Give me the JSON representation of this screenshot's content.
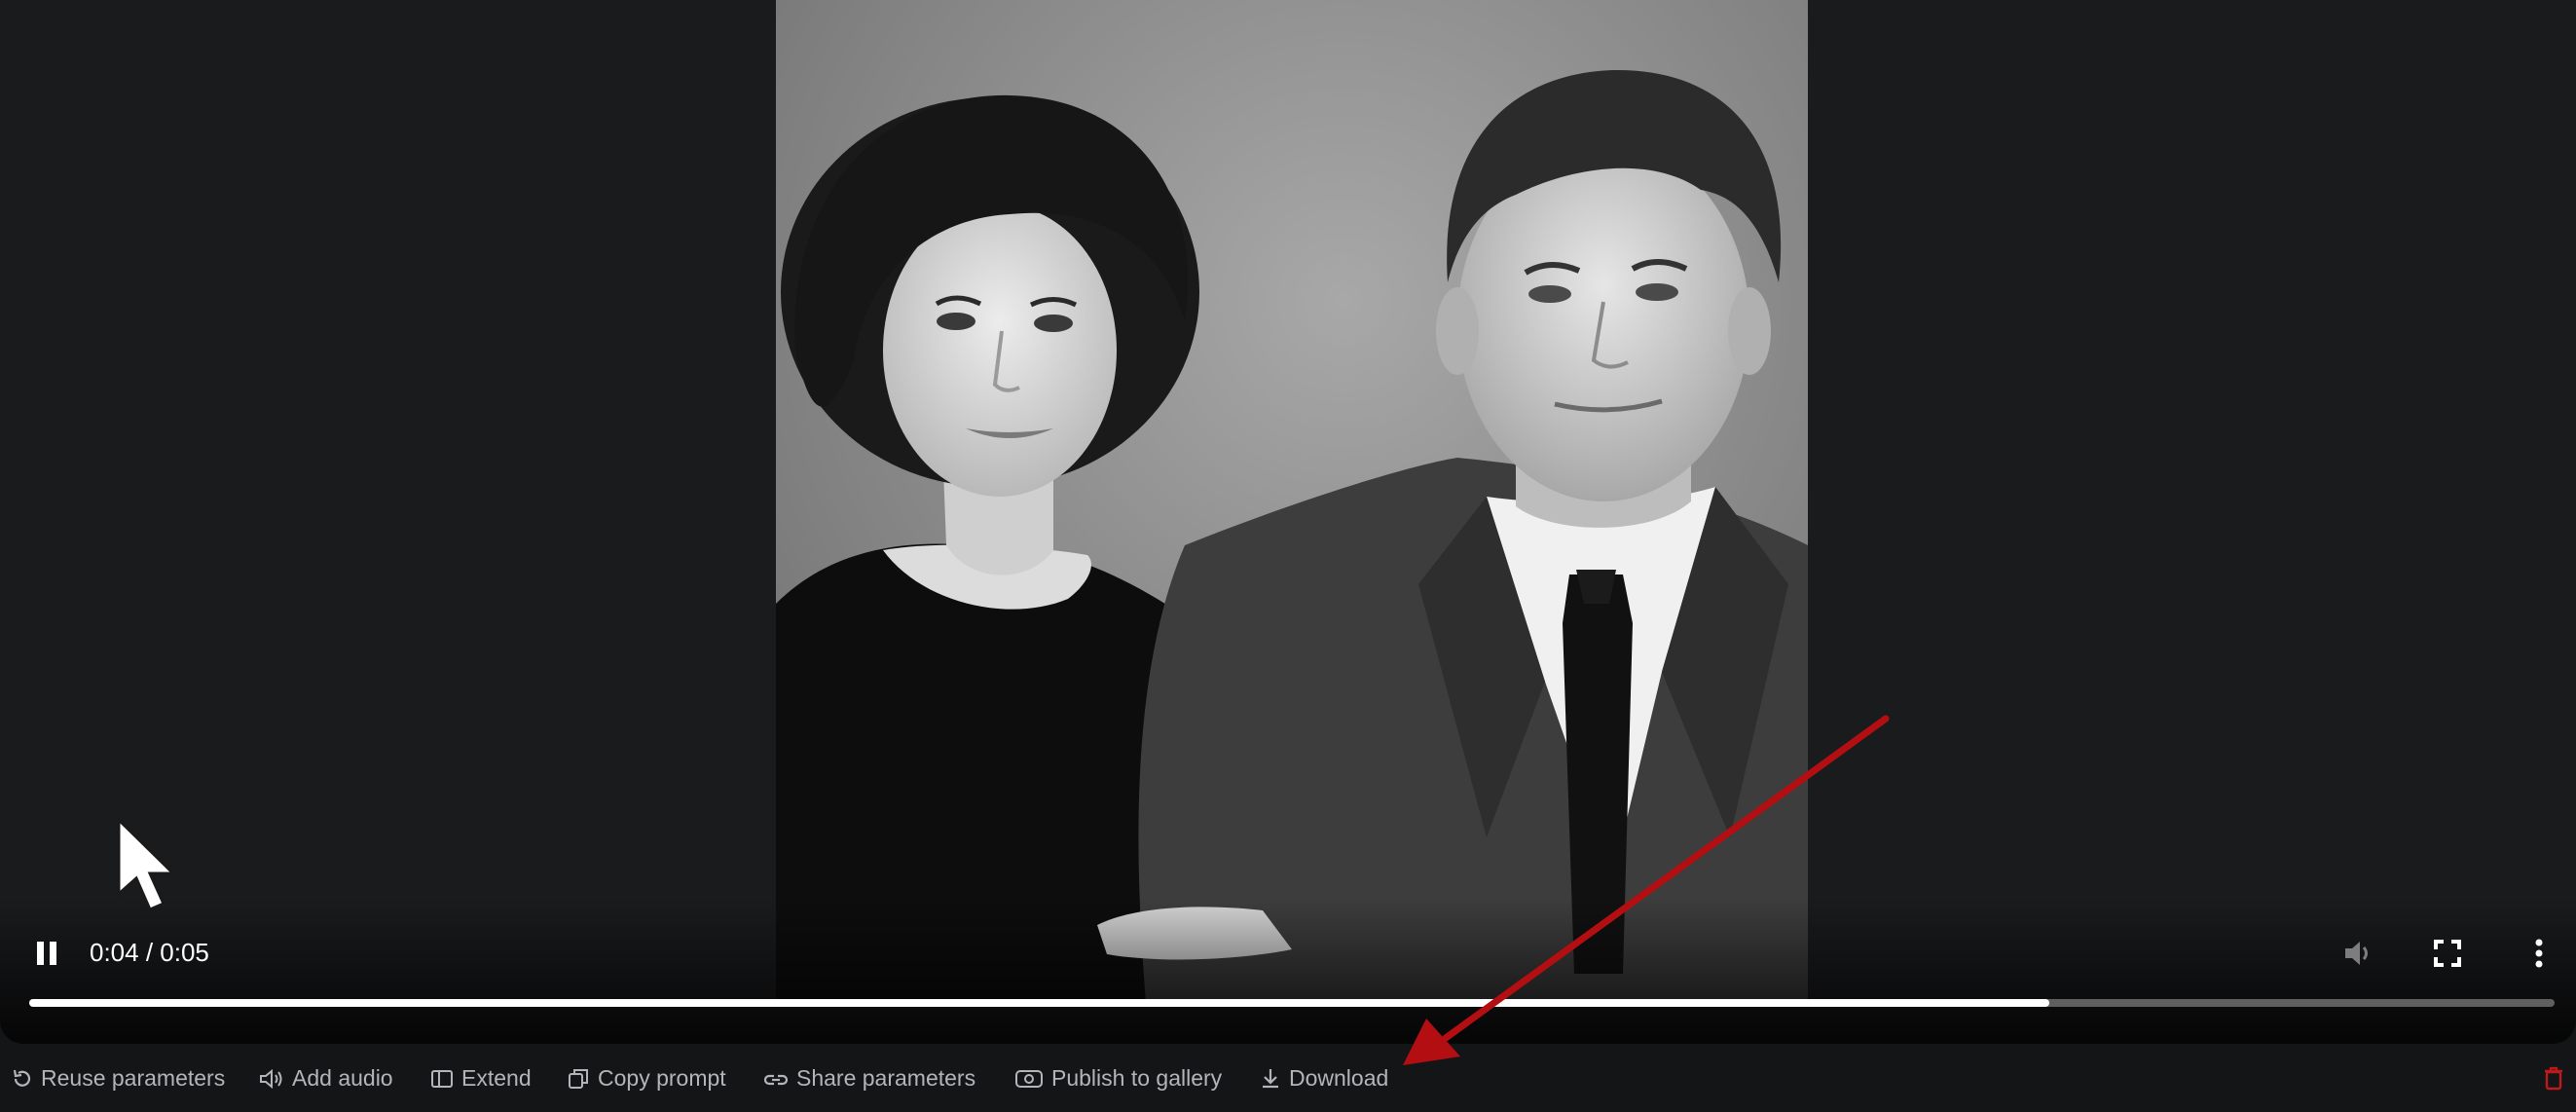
{
  "player": {
    "time_display": "0:04 / 0:05",
    "progress_fraction": 0.8,
    "buffered_fraction": 0.995,
    "icons": {
      "play_pause": "pause-icon",
      "volume": "volume-icon",
      "fullscreen": "fullscreen-icon",
      "more": "more-vertical-icon"
    }
  },
  "toolbar": {
    "reuse_label": "Reuse parameters",
    "add_audio_label": "Add audio",
    "extend_label": "Extend",
    "copy_prompt_label": "Copy prompt",
    "share_label": "Share parameters",
    "publish_label": "Publish to gallery",
    "download_label": "Download"
  },
  "colors": {
    "background": "#141517",
    "player_bg": "#1a1b1d",
    "toolbar_text": "#b3b5b8",
    "annotation_arrow": "#b30f12",
    "delete_icon": "#c0191c"
  }
}
